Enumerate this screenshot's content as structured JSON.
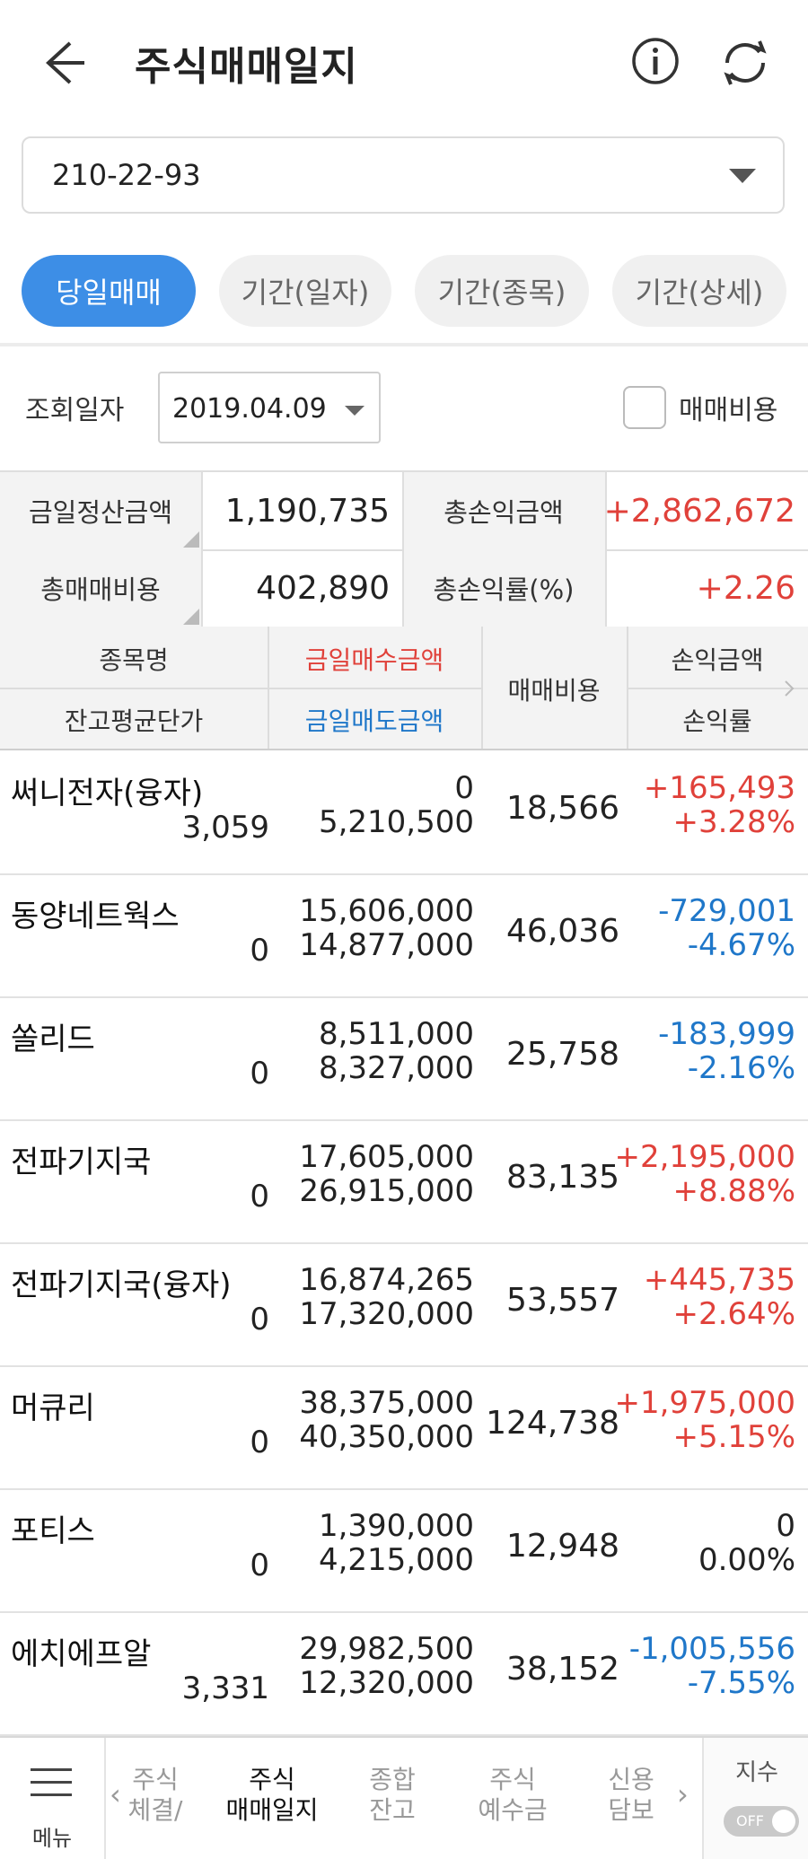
{
  "header": {
    "title": "주식매매일지",
    "icons": [
      "back-arrow-icon",
      "info-icon",
      "refresh-icon"
    ]
  },
  "account": {
    "value": "210-22-93"
  },
  "tabs": [
    {
      "label": "당일매매",
      "active": true
    },
    {
      "label": "기간(일자)",
      "active": false
    },
    {
      "label": "기간(종목)",
      "active": false
    },
    {
      "label": "기간(상세)",
      "active": false
    }
  ],
  "query": {
    "date_label": "조회일자",
    "date_value": "2019.04.09",
    "fee_checkbox_label": "매매비용",
    "fee_checked": false
  },
  "summary": {
    "settle_label": "금일정산금액",
    "settle_value": "1,190,735",
    "total_pl_label": "총손익금액",
    "total_pl_value": "+2,862,672",
    "total_fee_label": "총매매비용",
    "total_fee_value": "402,890",
    "total_rate_label": "총손익률(%)",
    "total_rate_value": "+2.26"
  },
  "table": {
    "headers": {
      "name": "종목명",
      "avg": "잔고평균단가",
      "buy": "금일매수금액",
      "sell": "금일매도금액",
      "fee": "매매비용",
      "pl": "손익금액",
      "rate": "손익률"
    },
    "rows": [
      {
        "name": "써니전자(융자)",
        "avg": "3,059",
        "buy": "0",
        "sell": "5,210,500",
        "fee": "18,566",
        "pl": "+165,493",
        "rate": "+3.28%",
        "dir": "red"
      },
      {
        "name": "동양네트웍스",
        "avg": "0",
        "buy": "15,606,000",
        "sell": "14,877,000",
        "fee": "46,036",
        "pl": "-729,001",
        "rate": "-4.67%",
        "dir": "blue"
      },
      {
        "name": "쏠리드",
        "avg": "0",
        "buy": "8,511,000",
        "sell": "8,327,000",
        "fee": "25,758",
        "pl": "-183,999",
        "rate": "-2.16%",
        "dir": "blue"
      },
      {
        "name": "전파기지국",
        "avg": "0",
        "buy": "17,605,000",
        "sell": "26,915,000",
        "fee": "83,135",
        "pl": "+2,195,000",
        "rate": "+8.88%",
        "dir": "red"
      },
      {
        "name": "전파기지국(융자)",
        "avg": "0",
        "buy": "16,874,265",
        "sell": "17,320,000",
        "fee": "53,557",
        "pl": "+445,735",
        "rate": "+2.64%",
        "dir": "red"
      },
      {
        "name": "머큐리",
        "avg": "0",
        "buy": "38,375,000",
        "sell": "40,350,000",
        "fee": "124,738",
        "pl": "+1,975,000",
        "rate": "+5.15%",
        "dir": "red"
      },
      {
        "name": "포티스",
        "avg": "0",
        "buy": "1,390,000",
        "sell": "4,215,000",
        "fee": "12,948",
        "pl": "0",
        "rate": "0.00%",
        "dir": "black"
      },
      {
        "name": "에치에프알",
        "avg": "3,331",
        "buy": "29,982,500",
        "sell": "12,320,000",
        "fee": "38,152",
        "pl": "-1,005,556",
        "rate": "-7.55%",
        "dir": "blue"
      }
    ]
  },
  "bottom_nav": {
    "menu_label": "메뉴",
    "items": [
      {
        "line1": "주식",
        "line2": "체결/",
        "selected": false
      },
      {
        "line1": "주식",
        "line2": "매매일지",
        "selected": true
      },
      {
        "line1": "종합",
        "line2": "잔고",
        "selected": false
      },
      {
        "line1": "주식",
        "line2": "예수금",
        "selected": false
      },
      {
        "line1": "신용",
        "line2": "담보",
        "selected": false
      }
    ],
    "index_label": "지수",
    "index_toggle": "OFF"
  },
  "colors": {
    "accent": "#3d8ee6",
    "up": "#e0413a",
    "down": "#1f77c9"
  }
}
